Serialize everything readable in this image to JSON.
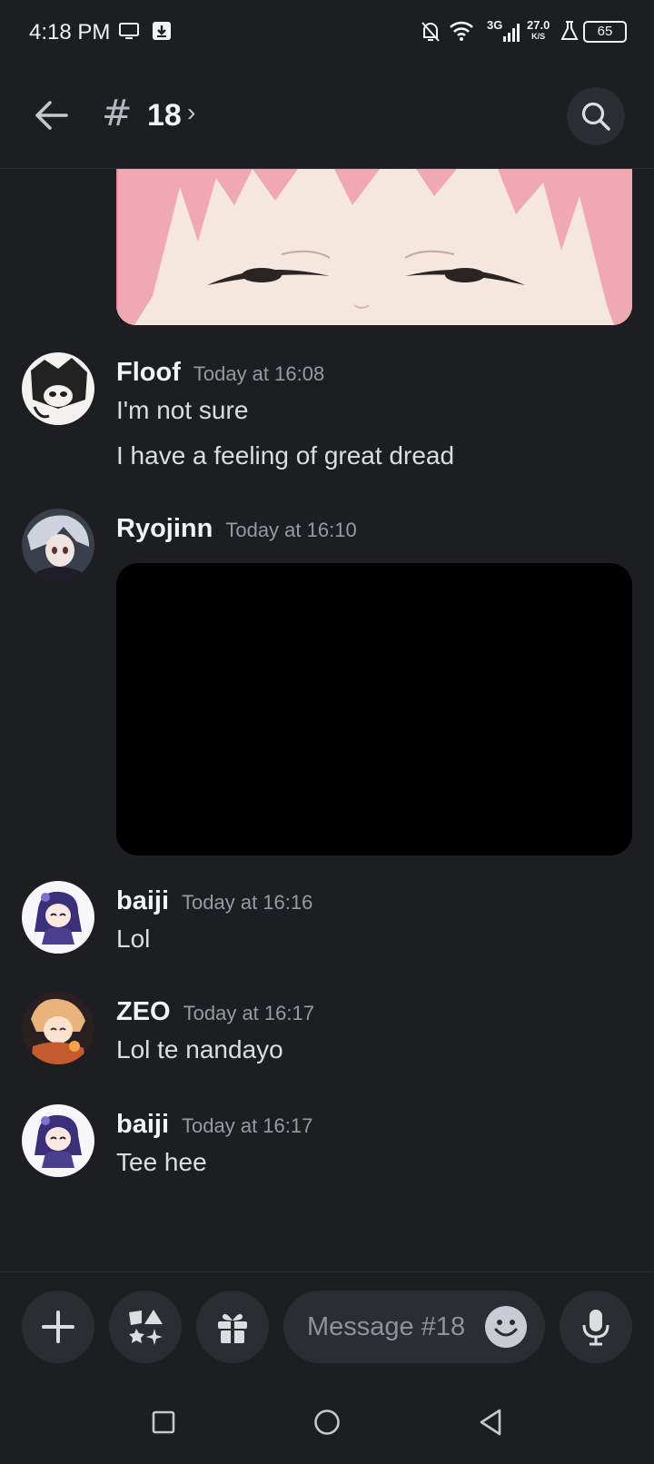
{
  "status_bar": {
    "time": "4:18 PM",
    "network": "3G",
    "speed_value": "27.0",
    "speed_unit": "K/S",
    "battery": "65",
    "icons": [
      "screen-icon",
      "download-icon",
      "bell-off-icon",
      "wifi-icon",
      "signal-icon",
      "flask-icon",
      "battery-icon"
    ]
  },
  "header": {
    "channel_hash": "#",
    "channel_name": "18",
    "chevron": "›",
    "back_icon": "arrow-left-icon",
    "search_icon": "search-icon"
  },
  "messages": [
    {
      "author": "Floof",
      "timestamp": "Today at 16:08",
      "lines": [
        "I'm not sure",
        "I have a feeling of great dread"
      ]
    },
    {
      "author": "Ryojinn",
      "timestamp": "Today at 16:10",
      "attachment": "video"
    },
    {
      "author": "baiji",
      "timestamp": "Today at 16:16",
      "lines": [
        "Lol"
      ]
    },
    {
      "author": "ZEO",
      "timestamp": "Today at 16:17",
      "lines": [
        "Lol te nandayo"
      ]
    },
    {
      "author": "baiji",
      "timestamp": "Today at 16:17",
      "lines": [
        "Tee hee"
      ]
    }
  ],
  "composer": {
    "placeholder": "Message #18",
    "buttons": [
      "plus-icon",
      "apps-icon",
      "gift-icon",
      "emoji-icon",
      "microphone-icon"
    ]
  },
  "nav": {
    "buttons": [
      "recents-square-icon",
      "home-circle-icon",
      "back-triangle-icon"
    ]
  },
  "colors": {
    "background": "#1d1e22",
    "surface": "#2b2d33",
    "text_primary": "#f2f3f5",
    "text_secondary": "#949ba4"
  }
}
